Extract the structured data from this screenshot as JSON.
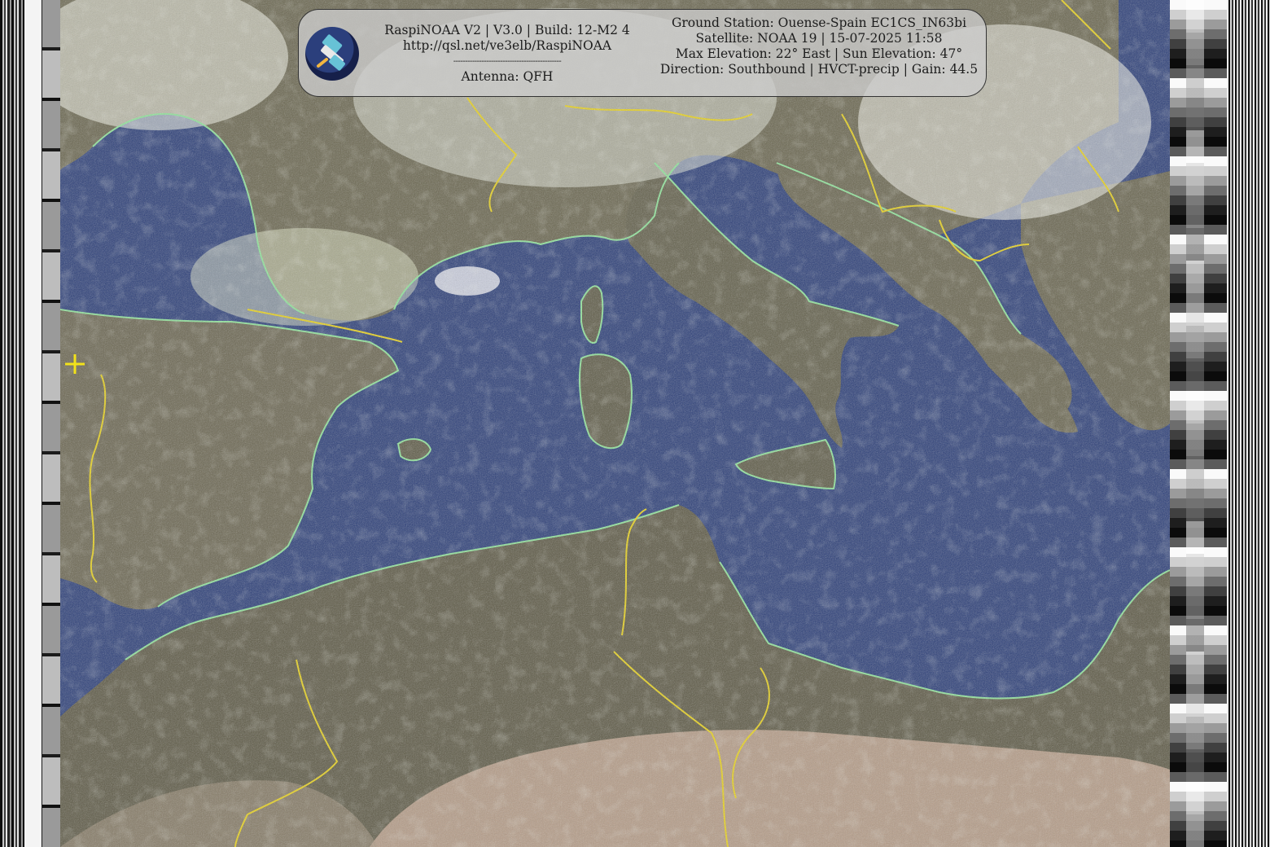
{
  "panel": {
    "title_line": "RaspiNOAA V2 | V3.0 | Build: 12-M2 4",
    "url_line": "http://qsl.net/ve3elb/RaspiNOAA",
    "divider": "----------------------------------------------",
    "antenna_line": "Antenna: QFH",
    "ground_station_line": "Ground Station: Ouense-Spain EC1CS_IN63bi",
    "satellite_line": "Satellite: NOAA 19 | 15-07-2025 11:58",
    "elevation_line": "Max Elevation: 22° East | Sun Elevation: 47°",
    "direction_line": "Direction: Southbound | HVCT-precip | Gain: 44.5",
    "logo_icon": "satellite-icon"
  },
  "map": {
    "colors": {
      "sea": "#2c3f79",
      "land": "#6e6450",
      "desert": "#c7ab96",
      "cloud": "#dfe6d8",
      "coastline": "#8fe39a",
      "border": "#e8d21d"
    }
  }
}
